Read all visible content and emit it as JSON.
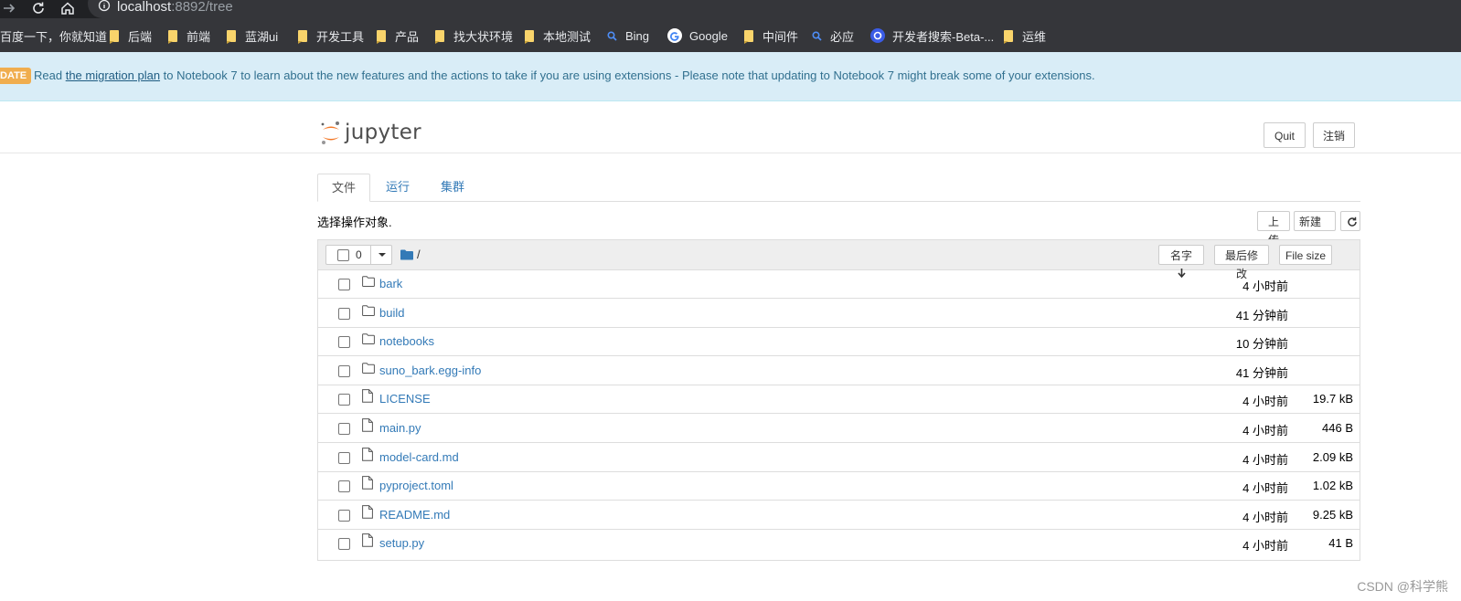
{
  "browser": {
    "url_host": "localhost",
    "url_path": ":8892/tree",
    "bookmarks": [
      {
        "label": "百度一下，你就知道",
        "icon": "none"
      },
      {
        "label": "后端",
        "icon": "folder-icon"
      },
      {
        "label": "前端",
        "icon": "folder-icon"
      },
      {
        "label": "蓝湖ui",
        "icon": "folder-icon"
      },
      {
        "label": "开发工具",
        "icon": "folder-icon"
      },
      {
        "label": "产品",
        "icon": "folder-icon"
      },
      {
        "label": "找大状环境",
        "icon": "folder-icon"
      },
      {
        "label": "本地测试",
        "icon": "folder-icon"
      },
      {
        "label": "Bing",
        "icon": "search-icon"
      },
      {
        "label": "Google",
        "icon": "google-icon"
      },
      {
        "label": "中间件",
        "icon": "folder-icon"
      },
      {
        "label": "必应",
        "icon": "search-icon"
      },
      {
        "label": "开发者搜索-Beta-...",
        "icon": "dev-search-icon"
      },
      {
        "label": "运维",
        "icon": "folder-icon"
      }
    ]
  },
  "banner": {
    "badge": "DATE",
    "pre": "Read ",
    "link": "the migration plan",
    "post": " to Notebook 7 to learn about the new features and the actions to take if you are using extensions - Please note that updating to Notebook 7 might break some of your extensions."
  },
  "header": {
    "logo_text": "jupyter",
    "quit_label": "Quit",
    "logout_label": "注销"
  },
  "tabs": [
    {
      "label": "文件",
      "active": true
    },
    {
      "label": "运行",
      "active": false
    },
    {
      "label": "集群",
      "active": false
    }
  ],
  "toolbar": {
    "hint": "选择操作对象.",
    "upload_label": "上传",
    "new_label": "新建",
    "refresh_icon": "refresh-icon"
  },
  "list_header": {
    "selected_count": "0",
    "path": "/",
    "sort_name_label": "名字",
    "sort_modified_label": "最后修改",
    "sort_size_label": "File size"
  },
  "files": [
    {
      "name": "bark",
      "type": "folder",
      "modified": "4 小时前",
      "size": ""
    },
    {
      "name": "build",
      "type": "folder",
      "modified": "41 分钟前",
      "size": ""
    },
    {
      "name": "notebooks",
      "type": "folder",
      "modified": "10 分钟前",
      "size": ""
    },
    {
      "name": "suno_bark.egg-info",
      "type": "folder",
      "modified": "41 分钟前",
      "size": ""
    },
    {
      "name": "LICENSE",
      "type": "file",
      "modified": "4 小时前",
      "size": "19.7 kB"
    },
    {
      "name": "main.py",
      "type": "file",
      "modified": "4 小时前",
      "size": "446 B"
    },
    {
      "name": "model-card.md",
      "type": "file",
      "modified": "4 小时前",
      "size": "2.09 kB"
    },
    {
      "name": "pyproject.toml",
      "type": "file",
      "modified": "4 小时前",
      "size": "1.02 kB"
    },
    {
      "name": "README.md",
      "type": "file",
      "modified": "4 小时前",
      "size": "9.25 kB"
    },
    {
      "name": "setup.py",
      "type": "file",
      "modified": "4 小时前",
      "size": "41 B"
    }
  ],
  "watermark": "CSDN @科学熊",
  "colors": {
    "link": "#337ab7",
    "banner_bg": "#d9edf7",
    "badge": "#f0ad4e",
    "jupyter_orange": "#f37726"
  }
}
